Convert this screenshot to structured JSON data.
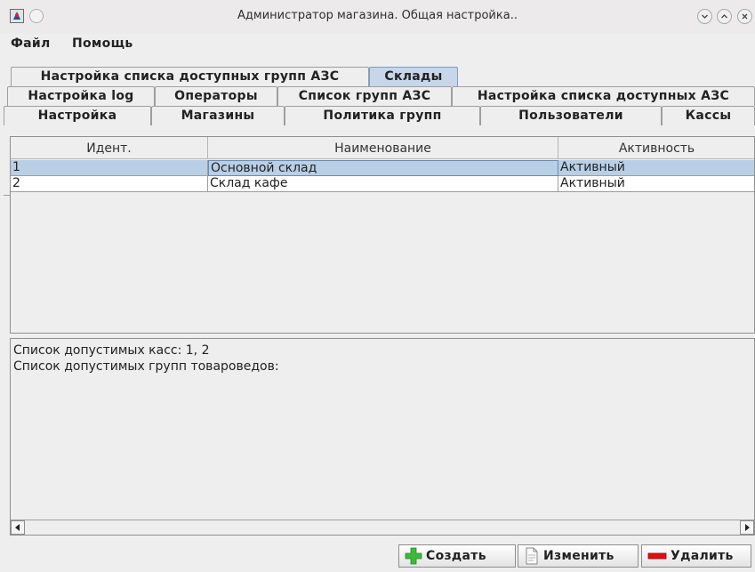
{
  "window": {
    "title": "Администратор магазина. Общая настройка.."
  },
  "menu": {
    "items": [
      "Файл",
      "Помощь"
    ]
  },
  "tabs": {
    "row1": [
      "Настройка списка доступных групп АЗС",
      "Склады"
    ],
    "row2": [
      "Настройка log",
      "Операторы",
      "Список групп АЗС",
      "Настройка списка доступных АЗС"
    ],
    "row3": [
      "Настройка",
      "Магазины",
      "Политика групп",
      "Пользователи",
      "Кассы"
    ],
    "selected": "Склады"
  },
  "table": {
    "columns": [
      "Идент.",
      "Наименование",
      "Активность"
    ],
    "rows": [
      [
        "1",
        "Основной склад",
        "Активный"
      ],
      [
        "2",
        "Склад кафе",
        "Активный"
      ]
    ],
    "selected_row": 0
  },
  "info": {
    "lines": [
      "Список допустимых касс: 1, 2",
      "Список допустимых групп товароведов:"
    ]
  },
  "buttons": {
    "create": "Создать",
    "edit": "Изменить",
    "delete": "Удалить"
  },
  "colors": {
    "selection": "#b8cfe5",
    "selected_tab": "#c7d6e8",
    "create_icon": "#3db83d",
    "delete_icon": "#dd1111"
  },
  "icons": {
    "app": "java-duke-icon",
    "create": "green-plus-icon",
    "edit": "document-icon",
    "delete": "red-minus-icon"
  }
}
